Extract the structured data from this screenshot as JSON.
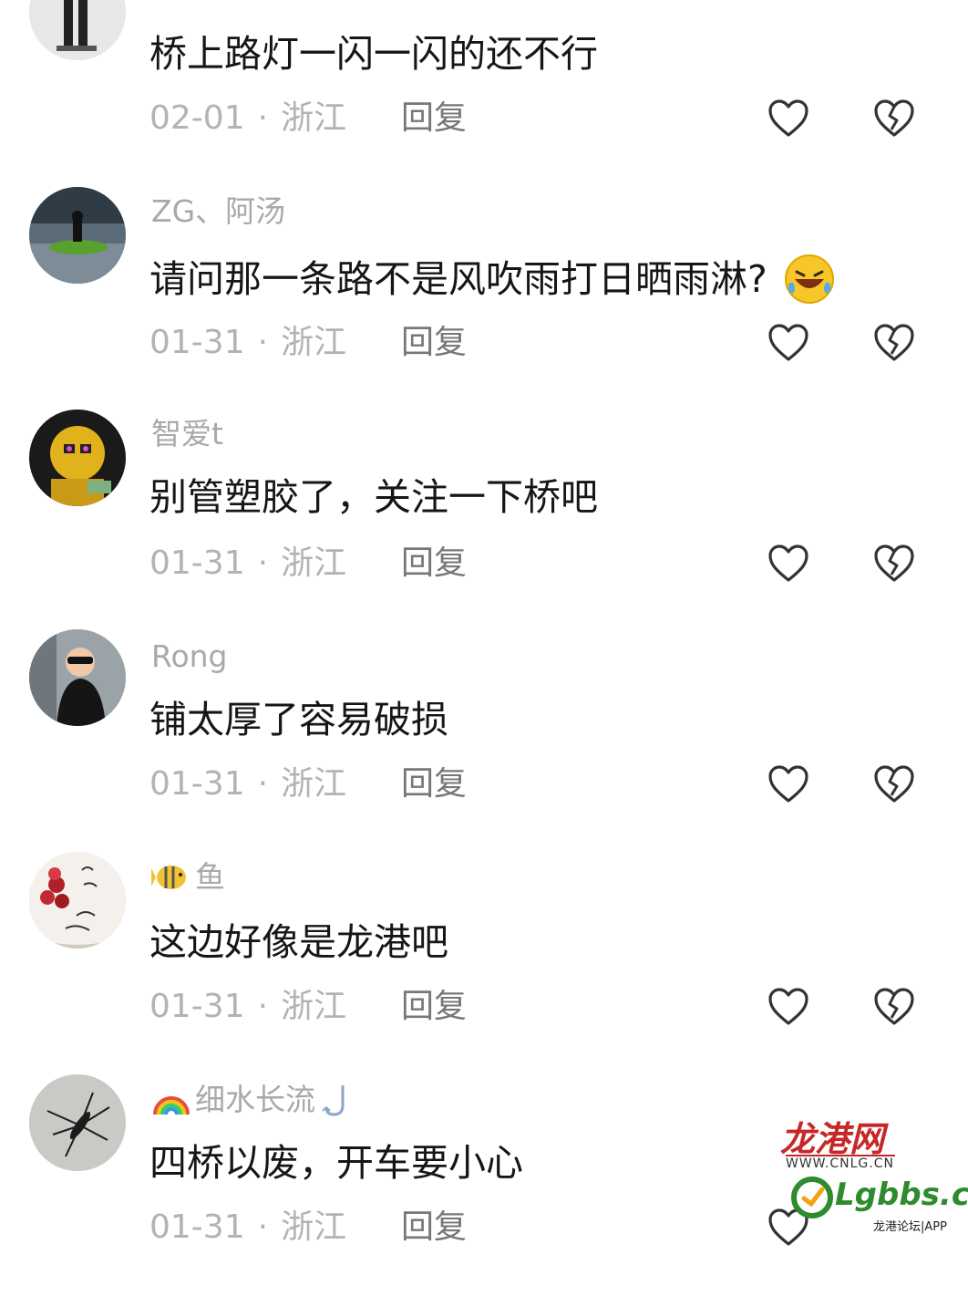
{
  "comments": [
    {
      "username": "",
      "text": "桥上路灯一闪一闪的还不行",
      "date": "02-01",
      "location": "浙江",
      "reply_label": "回复",
      "avatar": "person-standing-avatar"
    },
    {
      "username": "ZG、阿汤",
      "text": "请问那一条路不是风吹雨打日晒雨淋?",
      "date": "01-31",
      "location": "浙江",
      "reply_label": "回复",
      "avatar": "jetski-avatar",
      "trailing_emoji": "laughing-crying-emoji"
    },
    {
      "username": "智爱t",
      "text": "别管塑胶了，关注一下桥吧",
      "date": "01-31",
      "location": "浙江",
      "reply_label": "回复",
      "avatar": "golden-figure-avatar"
    },
    {
      "username": "Rong",
      "text": "铺太厚了容易破损",
      "date": "01-31",
      "location": "浙江",
      "reply_label": "回复",
      "avatar": "kid-sunglasses-avatar"
    },
    {
      "username": "鱼",
      "text": "这边好像是龙港吧",
      "date": "01-31",
      "location": "浙江",
      "reply_label": "回复",
      "avatar": "birthday-cake-avatar",
      "name_prefix_emoji": "fish-emoji"
    },
    {
      "username": "细水长流",
      "text": "四桥以废，开车要小心",
      "date": "01-31",
      "location": "浙江",
      "reply_label": "回复",
      "avatar": "insect-avatar",
      "name_prefix_emoji": "rainbow-emoji",
      "name_suffix_emoji": "fishing-hook-emoji"
    }
  ],
  "watermark": {
    "title": "龙港网",
    "url": "WWW.CNLG.CN",
    "brand": "Lgbbs.cn",
    "subtitle": "龙港论坛|APP"
  },
  "colors": {
    "text": "#161616",
    "username": "#a9a9a9",
    "meta": "#b3b3b3",
    "icon": "#333333",
    "watermark_red": "#c62828",
    "watermark_green": "#2e8b2e"
  }
}
